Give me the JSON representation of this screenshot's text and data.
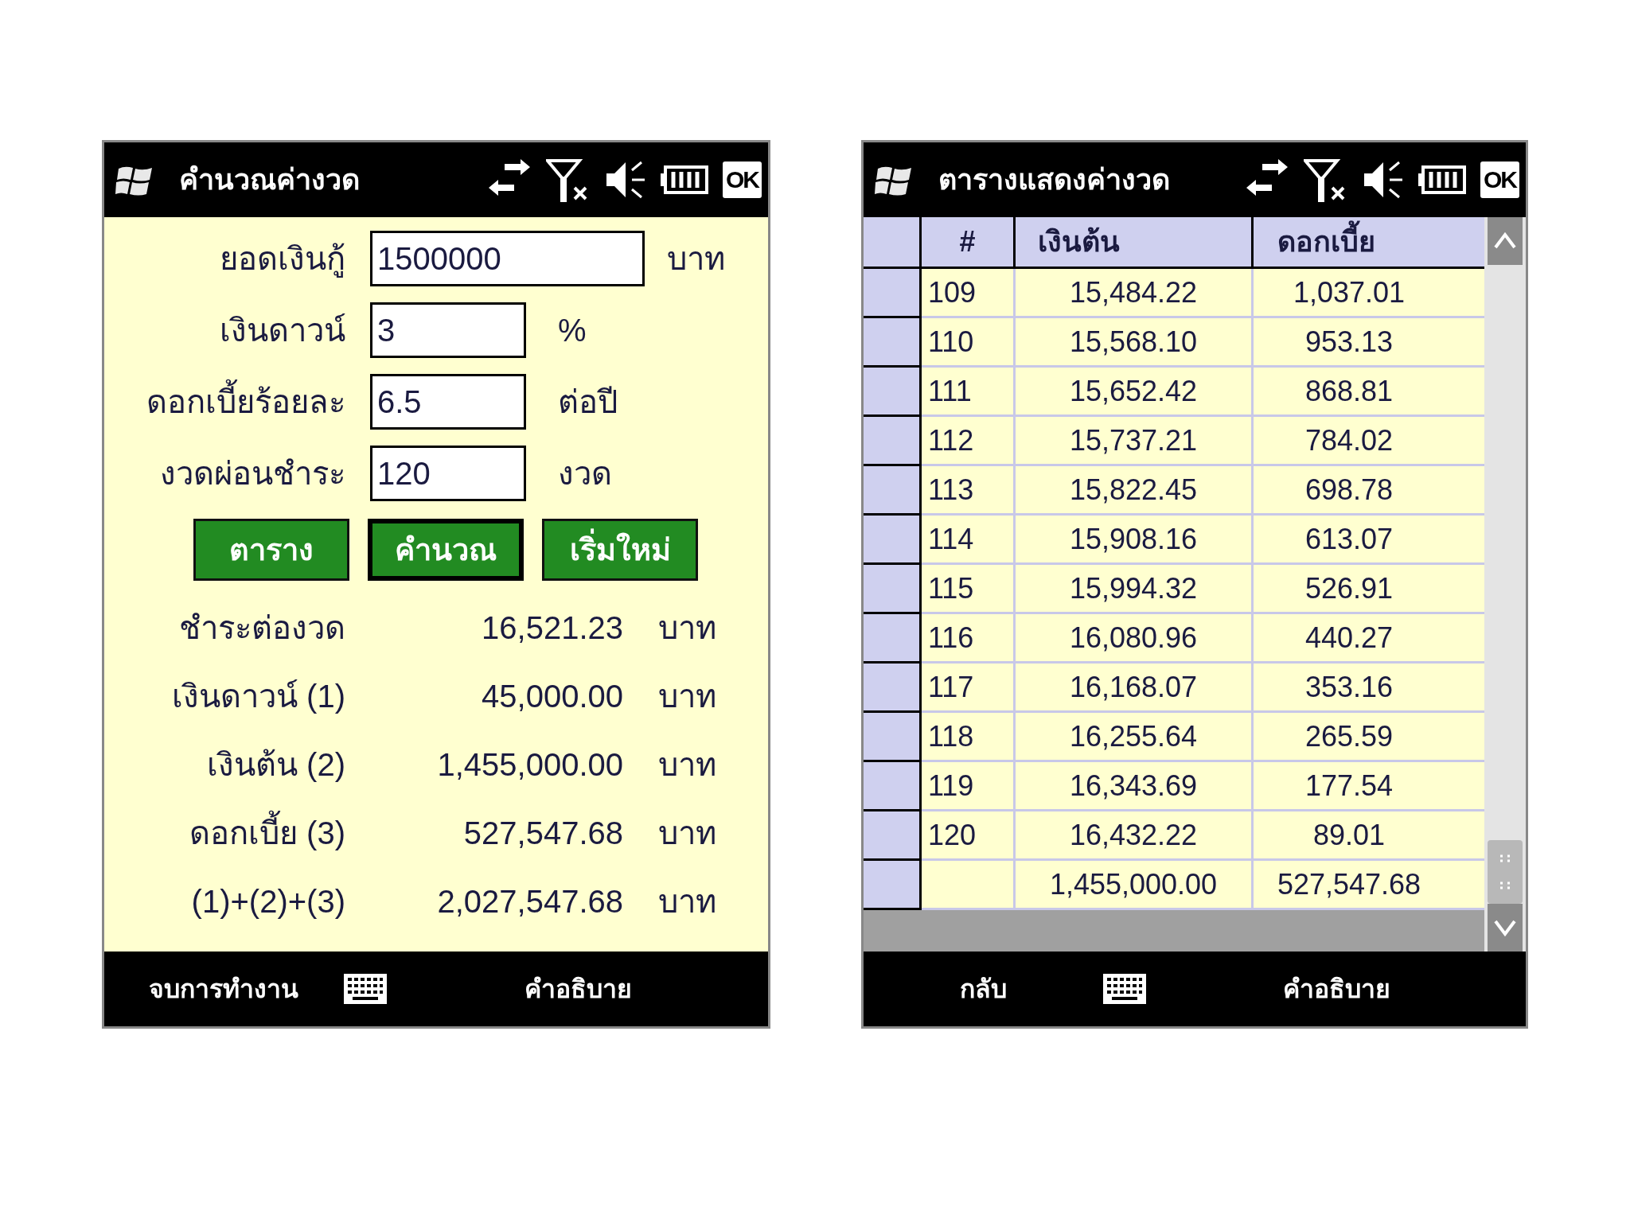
{
  "calculator": {
    "title": "คำนวณค่างวด",
    "ok_button": "OK",
    "inputs": [
      {
        "label": "ยอดเงินกู้",
        "value": "1500000",
        "unit": "บาท",
        "kind": "wide"
      },
      {
        "label": "เงินดาวน์",
        "value": "3",
        "unit": "%",
        "kind": "narrow"
      },
      {
        "label": "ดอกเบี้ยร้อยละ",
        "value": "6.5",
        "unit": "ต่อปี",
        "kind": "narrow"
      },
      {
        "label": "งวดผ่อนชำระ",
        "value": "120",
        "unit": "งวด",
        "kind": "narrow"
      }
    ],
    "buttons": [
      {
        "label": "ตาราง",
        "focused": false
      },
      {
        "label": "คำนวณ",
        "focused": true
      },
      {
        "label": "เริ่มใหม่",
        "focused": false
      }
    ],
    "results": [
      {
        "label": "ชำระต่องวด",
        "value": "16,521.23",
        "unit": "บาท"
      },
      {
        "label": "เงินดาวน์ (1)",
        "value": "45,000.00",
        "unit": "บาท"
      },
      {
        "label": "เงินต้น (2)",
        "value": "1,455,000.00",
        "unit": "บาท"
      },
      {
        "label": "ดอกเบี้ย (3)",
        "value": "527,547.68",
        "unit": "บาท"
      },
      {
        "label": "(1)+(2)+(3)",
        "value": "2,027,547.68",
        "unit": "บาท"
      }
    ],
    "softkeys": {
      "left": "จบการทำงาน",
      "right": "คำอธิบาย"
    }
  },
  "schedule": {
    "title": "ตารางแสดงค่างวด",
    "ok_button": "OK",
    "table": {
      "columns": [
        "#",
        "เงินต้น",
        "ดอกเบี้ย"
      ],
      "rows": [
        [
          "109",
          "15,484.22",
          "1,037.01"
        ],
        [
          "110",
          "15,568.10",
          "953.13"
        ],
        [
          "111",
          "15,652.42",
          "868.81"
        ],
        [
          "112",
          "15,737.21",
          "784.02"
        ],
        [
          "113",
          "15,822.45",
          "698.78"
        ],
        [
          "114",
          "15,908.16",
          "613.07"
        ],
        [
          "115",
          "15,994.32",
          "526.91"
        ],
        [
          "116",
          "16,080.96",
          "440.27"
        ],
        [
          "117",
          "16,168.07",
          "353.16"
        ],
        [
          "118",
          "16,255.64",
          "265.59"
        ],
        [
          "119",
          "16,343.69",
          "177.54"
        ],
        [
          "120",
          "16,432.22",
          "89.01"
        ]
      ],
      "total": {
        "principal": "1,455,000.00",
        "interest": "527,547.68"
      }
    },
    "softkeys": {
      "left": "กลับ",
      "right": "คำอธิบาย"
    }
  }
}
